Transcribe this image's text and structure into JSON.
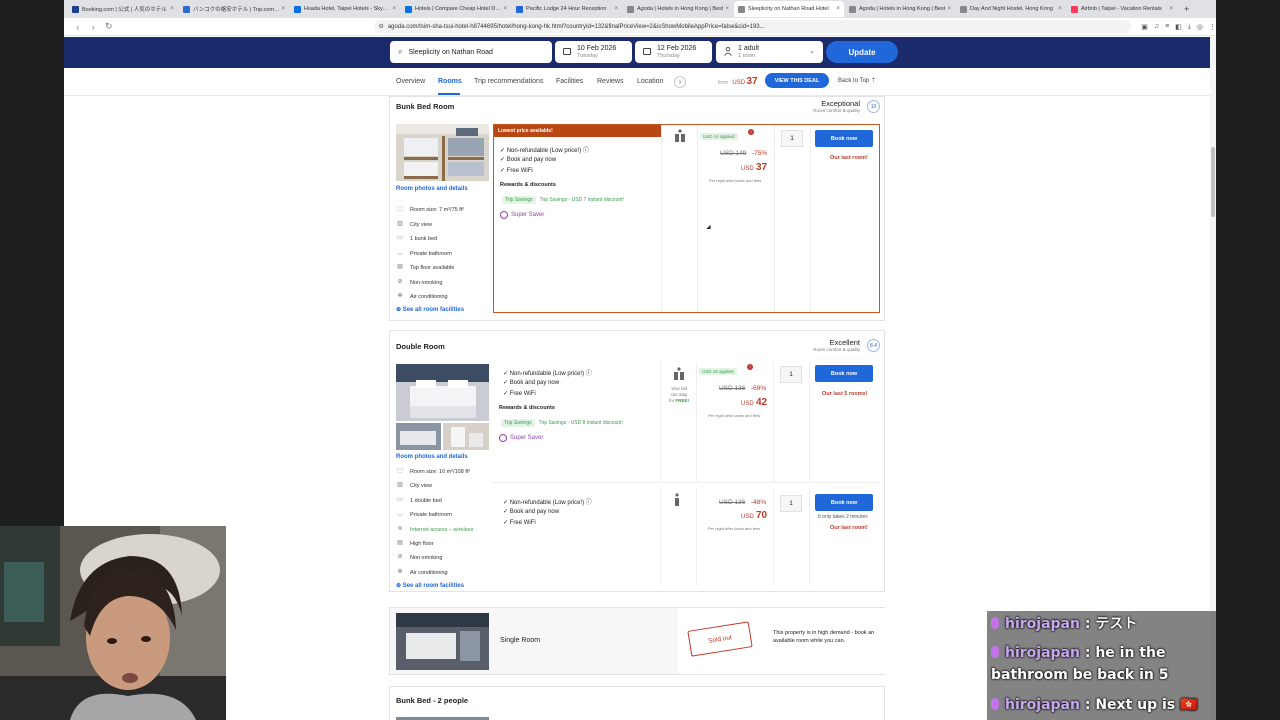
{
  "browser": {
    "tabs": [
      {
        "title": "Booking.com | 公式 | 人気のホテル",
        "color": "#1a3f8f"
      },
      {
        "title": "バンコクの格安ホテル | Trip.com ドロ",
        "color": "#2d6ad6"
      },
      {
        "title": "Hsada Hotel, Taipei Hotels - Skyscanner",
        "color": "#0770e3"
      },
      {
        "title": "Hotels | Compare Cheap Hotel Deals",
        "color": "#0770e3"
      },
      {
        "title": "Pacific Lodge 24 Hour Reception",
        "color": "#2067da"
      },
      {
        "title": "Agoda | Hotels in Hong Kong | Best",
        "color": "#888888"
      },
      {
        "title": "Sleeplicity on Nathan Road Hotel",
        "color": "#888888"
      },
      {
        "title": "Agoda | Hotels in Hong Kong | Best",
        "color": "#888888"
      },
      {
        "title": "Day And Night Hostel, Hong Kong",
        "color": "#888888"
      },
      {
        "title": "Airbnb | Taipei - Vacation Rentals",
        "color": "#ff385c"
      }
    ],
    "active_tab": 6,
    "url": "agoda.com/tsim-sha-tsui-hotel-h8744695/hotel/hong-kong-hk.html?countryId=132&finalPriceView=2&isShowMobileAppPrice=false&cid=193..."
  },
  "search": {
    "destination": "Sleeplicity on Nathan Road",
    "checkin_date": "10 Feb 2026",
    "checkin_day": "Tuesday",
    "checkout_date": "12 Feb 2026",
    "checkout_day": "Thursday",
    "guests": "1 adult",
    "rooms": "1 room",
    "update_label": "Update"
  },
  "subnav": {
    "items": [
      "Overview",
      "Rooms",
      "Trip recommendations",
      "Facilities",
      "Reviews",
      "Location"
    ],
    "from_label": "from",
    "from_currency": "USD",
    "from_amount": "37",
    "view_deal": "VIEW THIS DEAL",
    "back_to_top": "Back to Top"
  },
  "rooms": {
    "bunk": {
      "title": "Bunk Bed Room",
      "rating_word": "Exceptional",
      "rating_sub": "Room comfort & quality",
      "score": "10",
      "photos_link": "Room photos and details",
      "facilities": [
        "Room size: 7 m²/75 ft²",
        "City view",
        "1 bunk bed",
        "Private bathroom",
        "Top floor available",
        "Non-smoking",
        "Air conditioning"
      ],
      "see_all": "See all room facilities",
      "offer": {
        "banner": "Lowest price available!",
        "benefits": [
          "Non-refundable (Low price!)",
          "Book and pay now",
          "Free WiFi"
        ],
        "rewards_title": "Rewards & discounts",
        "trip_tag": "Trip Savings",
        "trip_text": "Trip Savings - USD 7 instant discount!",
        "super_saver": "Super Saver",
        "applied": "USD 14 applied",
        "original": "USD 149",
        "discount": "-75%",
        "currency": "USD",
        "price": "37",
        "per_night": "Per night after taxes and fees",
        "qty": "1",
        "book": "Book now",
        "urgency": "Our last room!"
      }
    },
    "double": {
      "title": "Double Room",
      "rating_word": "Excellent",
      "rating_sub": "Room comfort & quality",
      "score": "8.4",
      "photos_link": "Room photos and details",
      "facilities": [
        "Room size: 10 m²/108 ft²",
        "City view",
        "1 double bed",
        "Private bathroom",
        "Internet access – wireless",
        "High floor",
        "Non-smoking",
        "Air conditioning"
      ],
      "see_all": "See all room facilities",
      "offer1": {
        "benefits": [
          "Non-refundable (Low price!)",
          "Book and pay now",
          "Free WiFi"
        ],
        "rewards_title": "Rewards & discounts",
        "trip_tag": "Trip Savings",
        "trip_text": "Trip Savings - USD 8 instant discount!",
        "super_saver": "Super Saver",
        "occ_note_1": "Your kid",
        "occ_note_2": "can stay",
        "occ_note_3": "for",
        "occ_note_free": "FREE!",
        "applied": "USD 16 applied",
        "original": "USD 136",
        "discount": "-69%",
        "currency": "USD",
        "price": "42",
        "per_night": "Per night after taxes and fees",
        "qty": "1",
        "book": "Book now",
        "urgency": "Our last 5 rooms!"
      },
      "offer2": {
        "benefits": [
          "Non-refundable (Low price!)",
          "Book and pay now",
          "Free WiFi"
        ],
        "original": "USD 136",
        "discount": "-48%",
        "currency": "USD",
        "price": "70",
        "per_night": "Per night after taxes and fees",
        "qty": "1",
        "book": "Book now",
        "takes": "It only takes 2 minutes",
        "urgency": "Our last room!"
      }
    },
    "single": {
      "title": "Single Room",
      "sold_out": "Sold out",
      "demand": "This property is in high demand - book an available room while you can."
    },
    "bunk2": {
      "title": "Bunk Bed - 2 people"
    }
  },
  "chat": [
    {
      "user": "hirojapan",
      "text": "テスト"
    },
    {
      "user": "hirojapan",
      "text": "he in the bathroom be back in 5"
    },
    {
      "user": "hirojapan",
      "text": "Next up is 🇭🇰"
    }
  ]
}
